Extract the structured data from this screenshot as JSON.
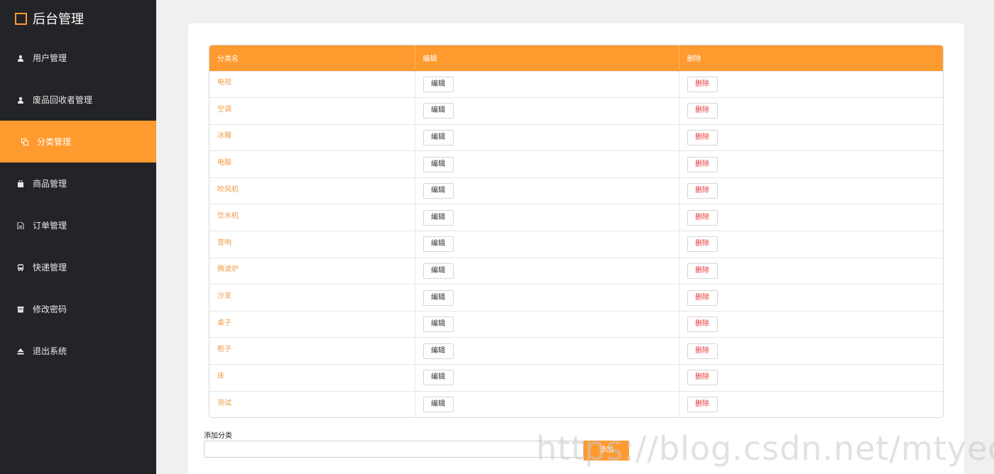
{
  "brand": {
    "title": "后台管理",
    "accent": "#ff9a2e"
  },
  "sidebar": {
    "items": [
      {
        "label": "用户管理",
        "icon": "user-icon",
        "active": false
      },
      {
        "label": "废品回收者管理",
        "icon": "user-icon",
        "active": false
      },
      {
        "label": "分类管理",
        "icon": "copy-icon",
        "active": true
      },
      {
        "label": "商品管理",
        "icon": "shopping-bag-icon",
        "active": false
      },
      {
        "label": "订单管理",
        "icon": "document-icon",
        "active": false
      },
      {
        "label": "快递管理",
        "icon": "bus-icon",
        "active": false
      },
      {
        "label": "修改密码",
        "icon": "archive-icon",
        "active": false
      },
      {
        "label": "退出系统",
        "icon": "eject-icon",
        "active": false
      }
    ]
  },
  "table": {
    "headers": [
      "分类名",
      "编辑",
      "删除"
    ],
    "edit_label": "编辑",
    "delete_label": "删除",
    "rows": [
      "电视",
      "空调",
      "冰箱",
      "电脑",
      "吹风机",
      "饮水机",
      "音响",
      "微波炉",
      "沙发",
      "桌子",
      "柜子",
      "床",
      "测试"
    ]
  },
  "add_form": {
    "label": "添加分类",
    "input_value": "",
    "button_label": "添加"
  },
  "watermark": "https://blog.csdn.net/mtyedu",
  "colors": {
    "sidebar_bg": "#232427",
    "accent": "#ff9a2e",
    "delete_text": "#e4393c",
    "category_text": "#f29a4a"
  }
}
